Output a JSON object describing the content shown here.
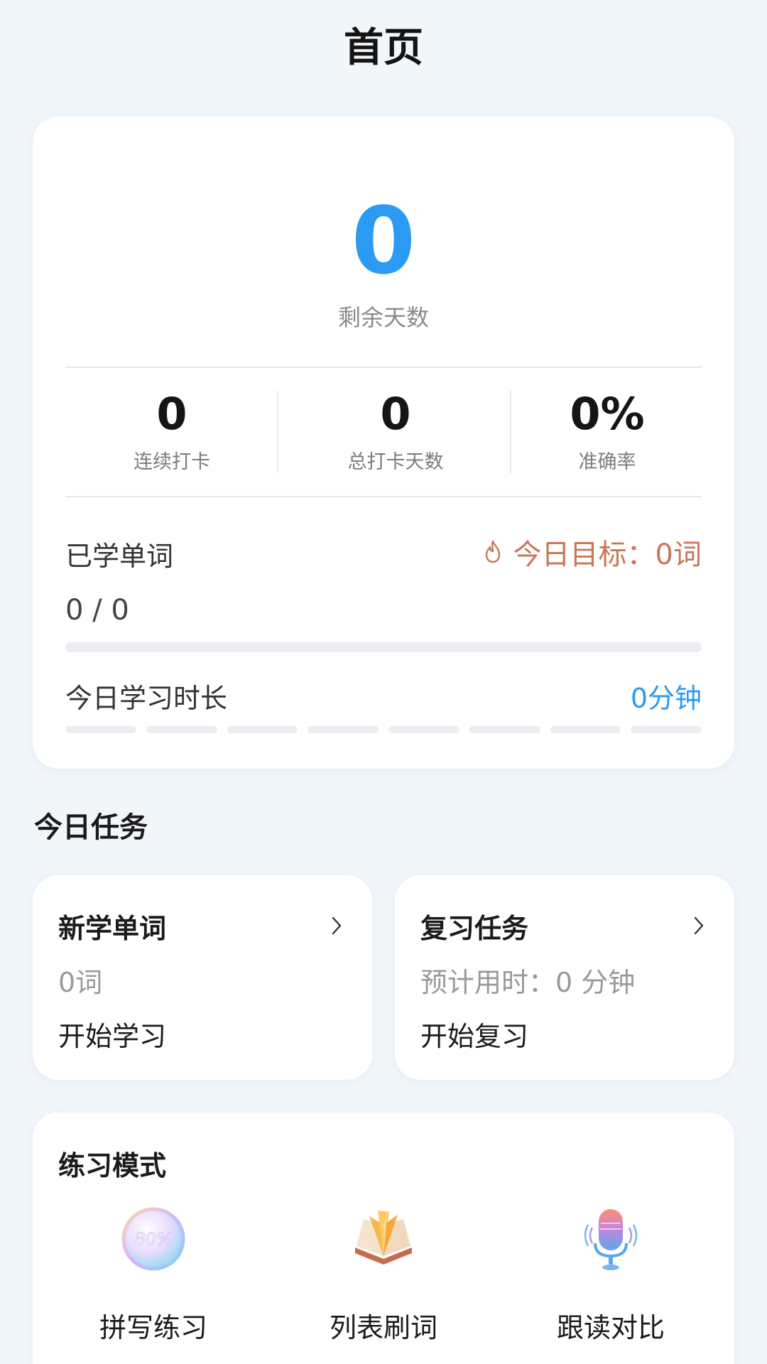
{
  "header": {
    "title": "首页"
  },
  "stats": {
    "remaining_days": "0",
    "remaining_label": "剩余天数",
    "items": [
      {
        "value": "0",
        "label": "连续打卡"
      },
      {
        "value": "0",
        "label": "总打卡天数"
      },
      {
        "value": "0%",
        "label": "准确率"
      }
    ],
    "learned_label": "已学单词",
    "goal_text": "今日目标：0词",
    "learned_count": "0 / 0",
    "learned_progress": 0,
    "duration_label": "今日学习时长",
    "duration_value": "0分钟",
    "duration_segments_filled": 0
  },
  "tasks": {
    "section_title": "今日任务",
    "new_words": {
      "title": "新学单词",
      "subtitle": "0词",
      "action": "开始学习"
    },
    "review": {
      "title": "复习任务",
      "subtitle": "预计用时：0 分钟",
      "action": "开始复习"
    }
  },
  "practice": {
    "title": "练习模式",
    "modes": [
      {
        "label": "拼写练习",
        "icon": "percent-badge-icon",
        "badge_text": "80%"
      },
      {
        "label": "列表刷词",
        "icon": "open-book-icon"
      },
      {
        "label": "跟读对比",
        "icon": "microphone-icon"
      }
    ]
  },
  "colors": {
    "accent": "#2b9af3",
    "goal": "#c9775a",
    "background": "#f1f6fb"
  }
}
